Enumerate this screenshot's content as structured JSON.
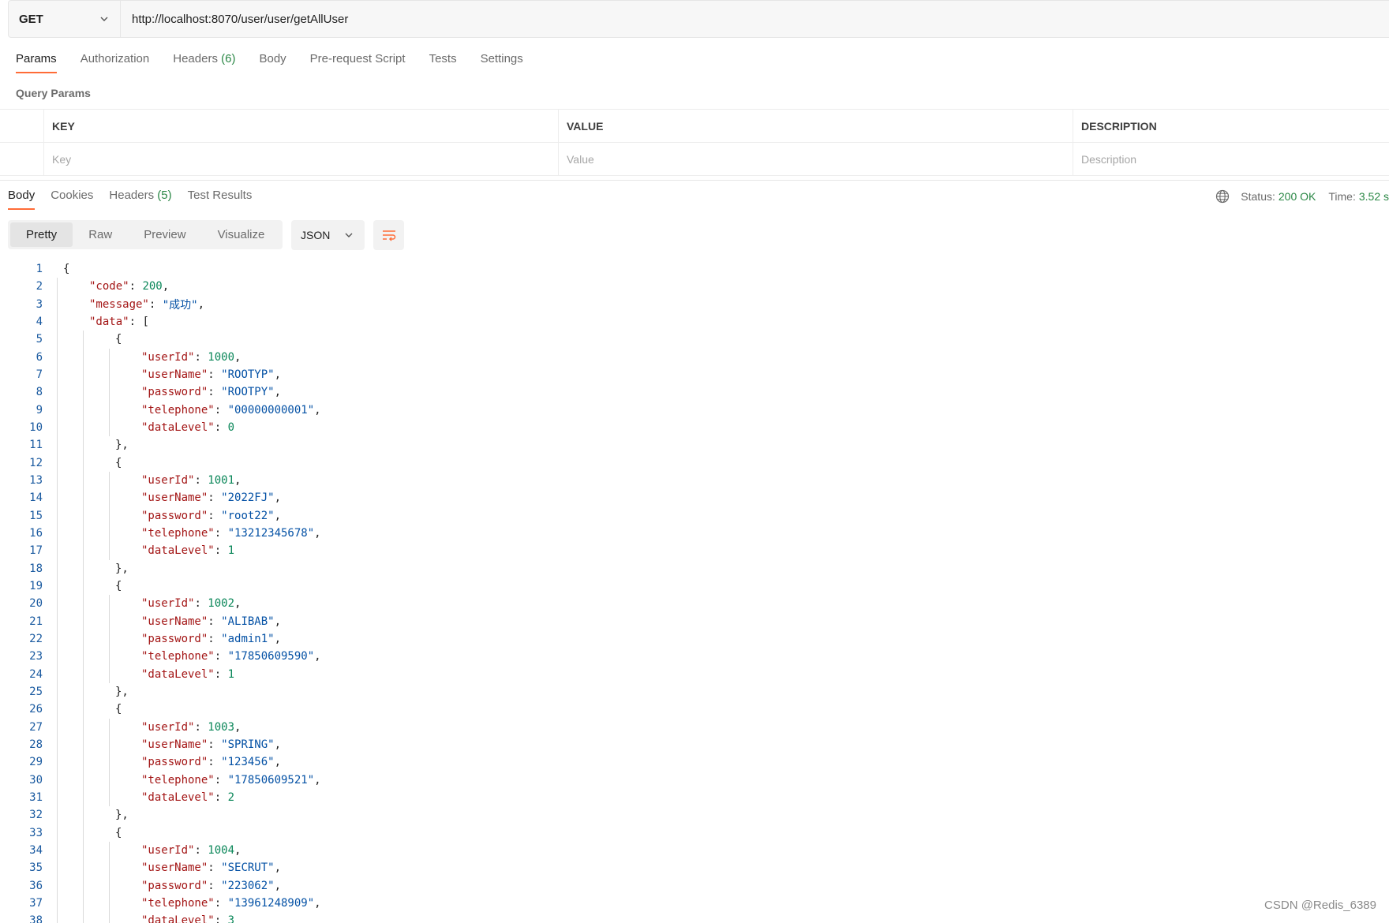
{
  "request": {
    "method": "GET",
    "url": "http://localhost:8070/user/user/getAllUser"
  },
  "request_tabs": [
    {
      "label": "Params",
      "count": "",
      "active": true
    },
    {
      "label": "Authorization",
      "count": "",
      "active": false
    },
    {
      "label": "Headers",
      "count": "(6)",
      "active": false
    },
    {
      "label": "Body",
      "count": "",
      "active": false
    },
    {
      "label": "Pre-request Script",
      "count": "",
      "active": false
    },
    {
      "label": "Tests",
      "count": "",
      "active": false
    },
    {
      "label": "Settings",
      "count": "",
      "active": false
    }
  ],
  "query_params": {
    "title": "Query Params",
    "headers": {
      "key": "KEY",
      "value": "VALUE",
      "description": "DESCRIPTION"
    },
    "placeholders": {
      "key": "Key",
      "value": "Value",
      "description": "Description"
    }
  },
  "response_tabs": [
    {
      "label": "Body",
      "count": "",
      "active": true
    },
    {
      "label": "Cookies",
      "count": "",
      "active": false
    },
    {
      "label": "Headers",
      "count": "(5)",
      "active": false
    },
    {
      "label": "Test Results",
      "count": "",
      "active": false
    }
  ],
  "status": {
    "status_label": "Status:",
    "status_value": "200 OK",
    "time_label": "Time:",
    "time_value": "3.52 s"
  },
  "view_modes": [
    {
      "label": "Pretty",
      "active": true
    },
    {
      "label": "Raw",
      "active": false
    },
    {
      "label": "Preview",
      "active": false
    },
    {
      "label": "Visualize",
      "active": false
    }
  ],
  "format": "JSON",
  "icons": {
    "method_dropdown": "chevron-down-icon",
    "format_dropdown": "chevron-down-icon",
    "wrap": "wrap-lines-icon",
    "network": "globe-icon"
  },
  "colors": {
    "accent": "#ff6c37",
    "success": "#2a8745",
    "key": "#a31515",
    "string": "#0451a5",
    "number": "#098658",
    "line_number": "#1a5aa0"
  },
  "response_body": {
    "code": 200,
    "message": "成功",
    "data": [
      {
        "userId": 1000,
        "userName": "ROOTYP",
        "password": "ROOTPY",
        "telephone": "00000000001",
        "dataLevel": 0
      },
      {
        "userId": 1001,
        "userName": "2022FJ",
        "password": "root22",
        "telephone": "13212345678",
        "dataLevel": 1
      },
      {
        "userId": 1002,
        "userName": "ALIBAB",
        "password": "admin1",
        "telephone": "17850609590",
        "dataLevel": 1
      },
      {
        "userId": 1003,
        "userName": "SPRING",
        "password": "123456",
        "telephone": "17850609521",
        "dataLevel": 2
      },
      {
        "userId": 1004,
        "userName": "SECRUT",
        "password": "223062",
        "telephone": "13961248909",
        "dataLevel": 3
      }
    ]
  },
  "visible_line_count": 38,
  "watermark": "CSDN @Redis_6389"
}
